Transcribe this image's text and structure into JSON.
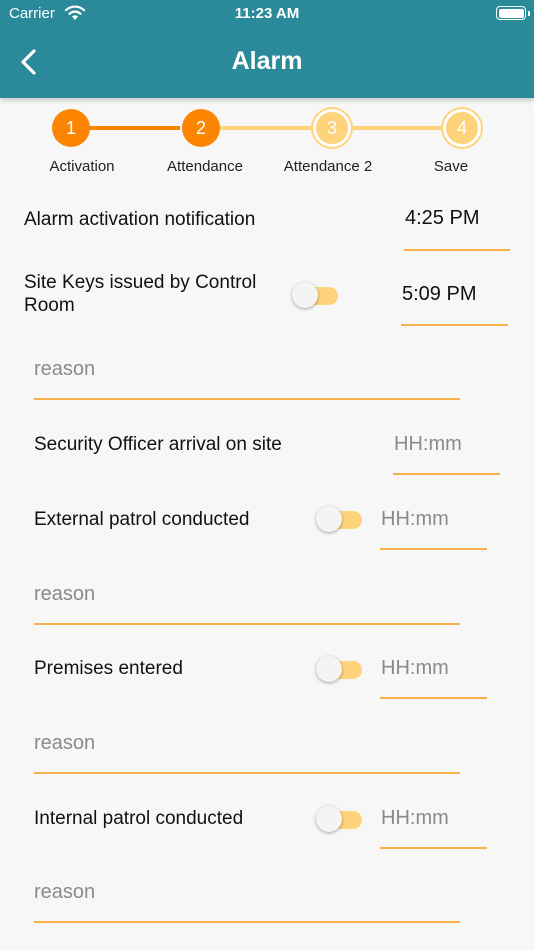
{
  "status_bar": {
    "carrier": "Carrier",
    "time": "11:23 AM"
  },
  "header": {
    "title": "Alarm"
  },
  "colors": {
    "header_bg": "#2b8a99",
    "accent": "#fb8500",
    "accent_light": "#ffd27c",
    "underline": "#f7b04a"
  },
  "stepper": {
    "steps": [
      {
        "number": "1",
        "label": "Activation",
        "state": "complete"
      },
      {
        "number": "2",
        "label": "Attendance",
        "state": "active"
      },
      {
        "number": "3",
        "label": "Attendance 2",
        "state": "pending"
      },
      {
        "number": "4",
        "label": "Save",
        "state": "pending"
      }
    ]
  },
  "form": {
    "alarm_activation": {
      "label": "Alarm activation notification",
      "time": "4:25 PM"
    },
    "site_keys": {
      "label": "Site Keys issued by Control Room",
      "toggle_on": false,
      "time": "5:09 PM",
      "reason_placeholder": "reason"
    },
    "officer_arrival": {
      "label": "Security Officer arrival on site",
      "time_placeholder": "HH:mm"
    },
    "external_patrol": {
      "label": "External patrol conducted",
      "toggle_on": false,
      "time_placeholder": "HH:mm",
      "reason_placeholder": "reason"
    },
    "premises_entered": {
      "label": "Premises entered",
      "toggle_on": false,
      "time_placeholder": "HH:mm",
      "reason_placeholder": "reason"
    },
    "internal_patrol": {
      "label": "Internal patrol conducted",
      "toggle_on": false,
      "time_placeholder": "HH:mm",
      "reason_placeholder": "reason"
    }
  }
}
